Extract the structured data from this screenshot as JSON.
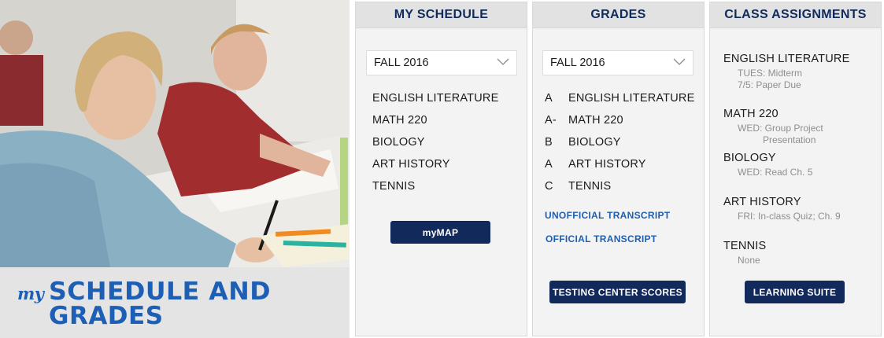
{
  "hero": {
    "prefix": "my",
    "title_line1": "SCHEDULE AND",
    "title_line2": "GRADES"
  },
  "schedule": {
    "heading": "MY SCHEDULE",
    "term": "FALL 2016",
    "courses": [
      "ENGLISH LITERATURE",
      "MATH 220",
      "BIOLOGY",
      "ART HISTORY",
      "TENNIS"
    ],
    "button": "myMAP"
  },
  "grades": {
    "heading": "GRADES",
    "term": "FALL 2016",
    "rows": [
      {
        "grade": "A",
        "course": "ENGLISH LITERATURE"
      },
      {
        "grade": "A-",
        "course": "MATH 220"
      },
      {
        "grade": "B",
        "course": "BIOLOGY"
      },
      {
        "grade": "A",
        "course": "ART HISTORY"
      },
      {
        "grade": "C",
        "course": "TENNIS"
      }
    ],
    "link_unofficial": "UNOFFICIAL TRANSCRIPT",
    "link_official": "OFFICIAL TRANSCRIPT",
    "button": "TESTING CENTER SCORES"
  },
  "assignments": {
    "heading": "CLASS ASSIGNMENTS",
    "items": [
      {
        "course": "ENGLISH LITERATURE",
        "details": [
          "TUES: Midterm",
          "7/5: Paper Due"
        ]
      },
      {
        "course": "MATH 220",
        "details": [
          "WED: Group Project",
          "Presentation"
        ]
      },
      {
        "course": "BIOLOGY",
        "details": [
          "WED: Read Ch. 5"
        ]
      },
      {
        "course": "ART HISTORY",
        "details": [
          "FRI: In-class Quiz; Ch. 9"
        ]
      },
      {
        "course": "TENNIS",
        "details": [
          "None"
        ]
      }
    ],
    "button": "LEARNING SUITE"
  },
  "colors": {
    "brand_blue": "#1d5fb5",
    "navy": "#12295b",
    "link_blue": "#1f5fb0",
    "panel_bg": "#f3f3f3",
    "panel_head_bg": "#e2e2e2"
  },
  "icons": [
    "chevron-down-icon"
  ]
}
